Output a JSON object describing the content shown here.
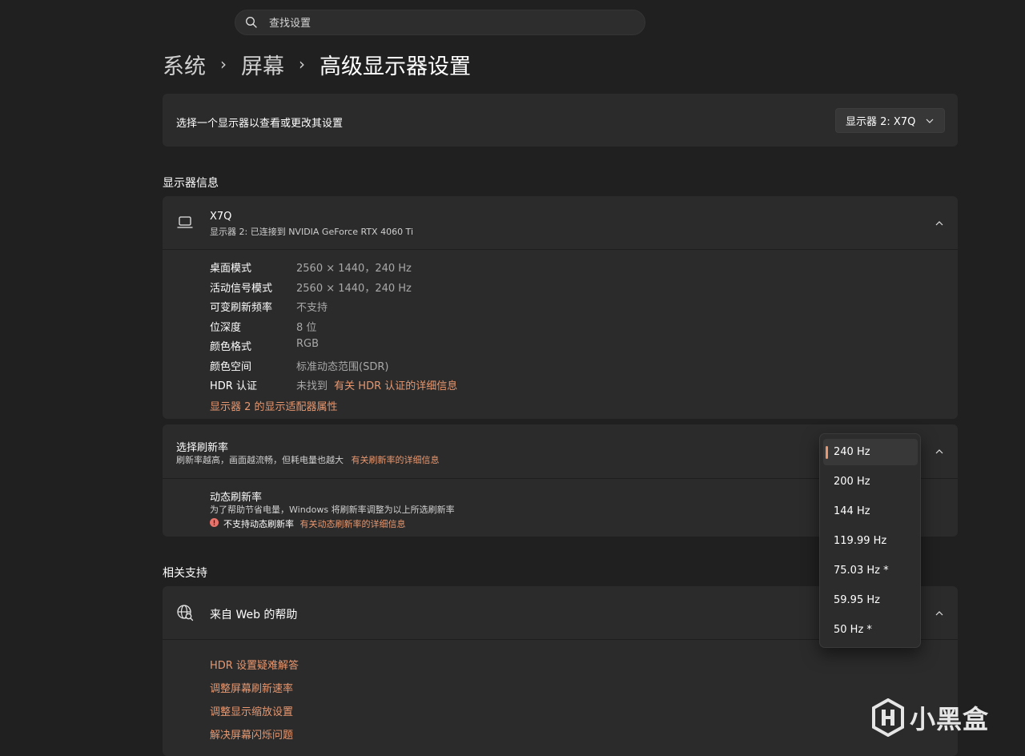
{
  "search": {
    "placeholder": "查找设置"
  },
  "breadcrumb": {
    "item1": "系统",
    "item2": "屏幕",
    "item3": "高级显示器设置"
  },
  "select_display": {
    "label": "选择一个显示器以查看或更改其设置",
    "dropdown_value": "显示器 2: X7Q"
  },
  "display_info": {
    "section_title": "显示器信息",
    "name": "X7Q",
    "connection": "显示器 2: 已连接到 NVIDIA GeForce RTX 4060 Ti",
    "rows": [
      {
        "label": "桌面模式",
        "value": "2560 × 1440，240 Hz"
      },
      {
        "label": "活动信号模式",
        "value": "2560 × 1440，240 Hz"
      },
      {
        "label": "可变刷新频率",
        "value": "不支持"
      },
      {
        "label": "位深度",
        "value": "8 位"
      },
      {
        "label": "颜色格式",
        "value": "RGB"
      },
      {
        "label": "颜色空间",
        "value": "标准动态范围(SDR)"
      },
      {
        "label": "HDR 认证",
        "value": "未找到",
        "link": "有关 HDR 认证的详细信息"
      }
    ],
    "adapter_link": "显示器 2 的显示适配器属性"
  },
  "refresh_rate": {
    "label": "选择刷新率",
    "description": "刷新率越高，画面越流畅，但耗电量也越大",
    "link": "有关刷新率的详细信息",
    "options": [
      "240 Hz",
      "200 Hz",
      "144 Hz",
      "119.99 Hz",
      "75.03 Hz *",
      "59.95 Hz",
      "50 Hz *"
    ],
    "selected": "240 Hz"
  },
  "dynamic_refresh": {
    "title": "动态刷新率",
    "description": "为了帮助节省电量，Windows 将刷新率调整为以上所选刷新率",
    "warning": "不支持动态刷新率",
    "link": "有关动态刷新率的详细信息"
  },
  "related": {
    "section_title": "相关支持",
    "web_help": "来自 Web 的帮助",
    "links": [
      "HDR 设置疑难解答",
      "调整屏幕刷新速率",
      "调整显示缩放设置",
      "解决屏幕闪烁问题"
    ]
  },
  "watermark": {
    "text": "小黑盒"
  },
  "colors": {
    "accent": "#e8976f",
    "background": "#202020",
    "card": "#2b2b2b"
  }
}
